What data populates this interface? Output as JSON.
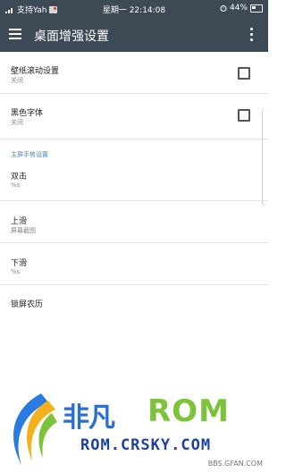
{
  "status_bar": {
    "carrier": "支持Yah",
    "datetime": "星期一 22:14:08",
    "battery": "44%"
  },
  "appbar": {
    "title": "桌面增强设置"
  },
  "settings": {
    "wallpaper_scroll": {
      "title": "壁纸滚动设置",
      "summary": "关闭",
      "checked": false
    },
    "black_font": {
      "title": "黑色字体",
      "summary": "关闭",
      "checked": false
    },
    "gesture_section_header": "主屏手势设置",
    "double_tap": {
      "title": "双击",
      "summary": "%s"
    },
    "swipe_up": {
      "title": "上滑",
      "summary": "屏幕截图"
    },
    "swipe_down": {
      "title": "下滑",
      "summary": "%s"
    },
    "lockscreen_lunar": {
      "title": "锁屏农历"
    }
  },
  "watermark": {
    "brand_cn": "非凡",
    "brand_rom": "ROM",
    "url": "ROM.CRSKY.COM",
    "bbs": "BBS.GFAN.COM"
  },
  "colors": {
    "toolbar": "#3d4a56",
    "section_header": "#4a86b8"
  }
}
